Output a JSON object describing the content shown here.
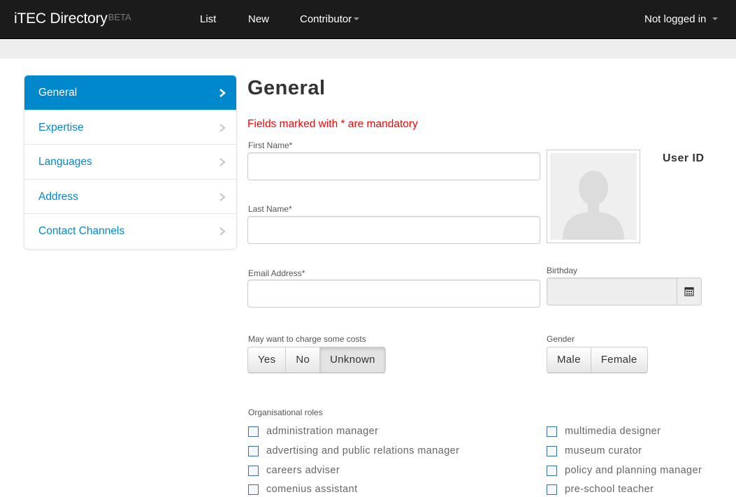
{
  "navbar": {
    "brand": "iTEC Directory",
    "brand_badge": "BETA",
    "links": [
      "List",
      "New",
      "Contributor"
    ],
    "user": "Not logged in"
  },
  "sidebar": {
    "items": [
      {
        "label": "General",
        "active": true
      },
      {
        "label": "Expertise",
        "active": false
      },
      {
        "label": "Languages",
        "active": false
      },
      {
        "label": "Address",
        "active": false
      },
      {
        "label": "Contact Channels",
        "active": false
      }
    ]
  },
  "main": {
    "title": "General",
    "mandatory_note": "Fields marked with * are mandatory",
    "first_name": {
      "label": "First Name*",
      "value": ""
    },
    "last_name": {
      "label": "Last Name*",
      "value": ""
    },
    "email": {
      "label": "Email Address*",
      "value": ""
    },
    "birthday": {
      "label": "Birthday",
      "value": ""
    },
    "user_id_label": "User ID",
    "charge_costs": {
      "label": "May want to charge some costs",
      "options": [
        "Yes",
        "No",
        "Unknown"
      ],
      "selected": "Unknown"
    },
    "gender": {
      "label": "Gender",
      "options": [
        "Male",
        "Female"
      ],
      "selected": ""
    },
    "roles": {
      "label": "Organisational roles",
      "left": [
        "administration manager",
        "advertising and public relations manager",
        "careers adviser",
        "comenius assistant"
      ],
      "right": [
        "multimedia designer",
        "museum curator",
        "policy and planning manager",
        "pre-school teacher"
      ]
    }
  },
  "colors": {
    "navbar_bg": "#1b1b1b",
    "accent": "#0088cc",
    "mandatory": "#ff0000"
  },
  "icons": {
    "sidebar_chevron": "chevron-right-icon",
    "birthday_addon": "calendar-icon",
    "avatar": "user-silhouette-icon",
    "dropdown": "caret-down-icon"
  }
}
